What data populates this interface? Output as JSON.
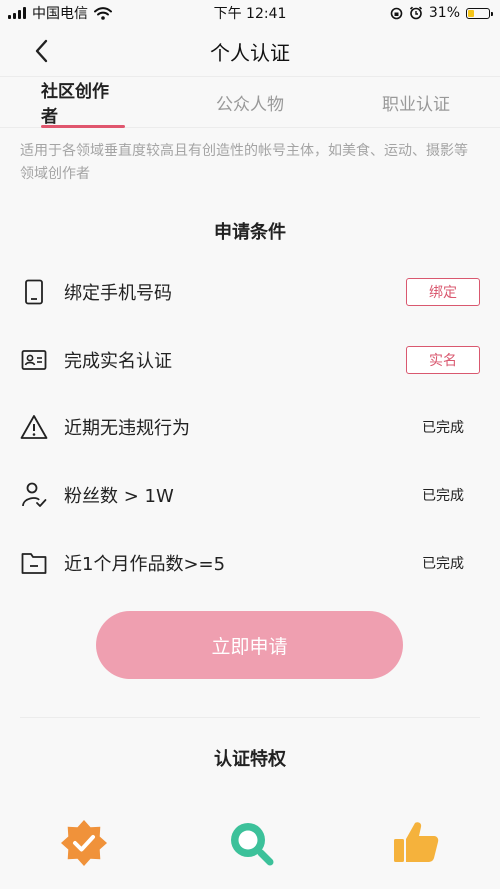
{
  "status_bar": {
    "carrier": "中国电信",
    "time": "下午 12:41",
    "battery_pct": "31%",
    "battery_level": 0.31,
    "battery_color": "#f5c518"
  },
  "nav": {
    "title": "个人认证",
    "back_icon": "chevron-left-icon"
  },
  "tabs": [
    {
      "label": "社区创作者",
      "active": true
    },
    {
      "label": "公众人物",
      "active": false
    },
    {
      "label": "职业认证",
      "active": false
    }
  ],
  "description": "适用于各领域垂直度较高且有创造性的帐号主体，如美食、运动、摄影等领域创作者",
  "conditions": {
    "title": "申请条件",
    "items": [
      {
        "icon": "phone-icon",
        "label": "绑定手机号码",
        "action": "绑定"
      },
      {
        "icon": "id-card-icon",
        "label": "完成实名认证",
        "action": "实名"
      },
      {
        "icon": "warning-icon",
        "label": "近期无违规行为",
        "status": "已完成"
      },
      {
        "icon": "user-check-icon",
        "label": "粉丝数 > 1W",
        "status": "已完成"
      },
      {
        "icon": "folder-icon",
        "label": "近1个月作品数>=5",
        "status": "已完成"
      }
    ]
  },
  "apply_button": "立即申请",
  "privileges": {
    "title": "认证特权",
    "icons": [
      "verified-badge-icon",
      "search-icon",
      "thumbs-up-icon"
    ]
  },
  "colors": {
    "accent": "#e0566e",
    "button_pink": "#ef9fb0",
    "badge_orange": "#f0923a",
    "search_green": "#3cc19a",
    "thumb_yellow": "#f5b23c"
  }
}
